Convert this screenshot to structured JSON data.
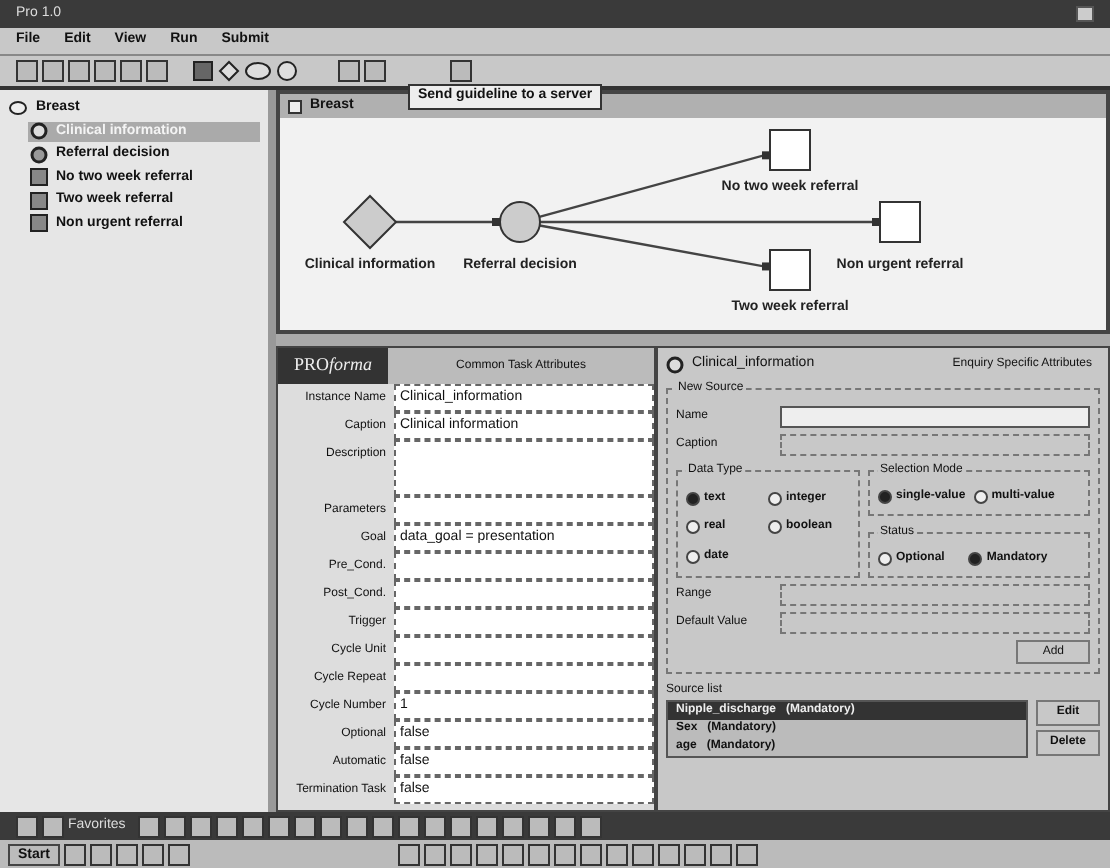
{
  "window": {
    "title": "Pro 1.0"
  },
  "menu": [
    "File",
    "Edit",
    "View",
    "Run",
    "Submit"
  ],
  "tooltip": "Send guideline to a server",
  "tree": {
    "root": "Breast",
    "children": [
      {
        "label": "Clinical information",
        "kind": "enquiry",
        "selected": true
      },
      {
        "label": "Referral decision",
        "kind": "decision",
        "selected": false
      },
      {
        "label": "No two week referral",
        "kind": "action",
        "selected": false
      },
      {
        "label": "Two week referral",
        "kind": "action",
        "selected": false
      },
      {
        "label": "Non urgent referral",
        "kind": "action",
        "selected": false
      }
    ]
  },
  "diagram": {
    "title": "Breast",
    "nodes": [
      {
        "label": "Clinical information",
        "kind": "enquiry"
      },
      {
        "label": "Referral decision",
        "kind": "decision"
      },
      {
        "label": "No two week referral",
        "kind": "action"
      },
      {
        "label": "Non urgent referral",
        "kind": "action"
      },
      {
        "label": "Two week referral",
        "kind": "action"
      }
    ]
  },
  "form": {
    "logo_main": "PRO",
    "logo_italic": "forma",
    "tab": "Common Task Attributes",
    "rows": [
      {
        "label": "Instance Name",
        "value": "Clinical_information",
        "tall": false
      },
      {
        "label": "Caption",
        "value": "Clinical information",
        "tall": false
      },
      {
        "label": "Description",
        "value": "",
        "tall": true
      },
      {
        "label": "Parameters",
        "value": "",
        "tall": false
      },
      {
        "label": "Goal",
        "value": "data_goal = presentation",
        "tall": false
      },
      {
        "label": "Pre_Cond.",
        "value": "",
        "tall": false
      },
      {
        "label": "Post_Cond.",
        "value": "",
        "tall": false
      },
      {
        "label": "Trigger",
        "value": "",
        "tall": false
      },
      {
        "label": "Cycle Unit",
        "value": "",
        "tall": false
      },
      {
        "label": "Cycle Repeat",
        "value": "",
        "tall": false
      },
      {
        "label": "Cycle Number",
        "value": "1",
        "tall": false
      },
      {
        "label": "Optional",
        "value": "false",
        "tall": false
      },
      {
        "label": "Automatic",
        "value": "false",
        "tall": false
      },
      {
        "label": "Termination Task",
        "value": "false",
        "tall": false
      }
    ]
  },
  "enquiry": {
    "name": "Clinical_information",
    "tab": "Enquiry Specific Attributes",
    "group": "New Source",
    "name_label": "Name",
    "caption_label": "Caption",
    "data_type": {
      "title": "Data Type",
      "options": [
        {
          "label": "text",
          "selected": true
        },
        {
          "label": "integer",
          "selected": false
        },
        {
          "label": "real",
          "selected": false
        },
        {
          "label": "boolean",
          "selected": false
        },
        {
          "label": "date",
          "selected": false
        }
      ]
    },
    "selection_mode": {
      "title": "Selection Mode",
      "options": [
        {
          "label": "single-value",
          "selected": true
        },
        {
          "label": "multi-value",
          "selected": false
        }
      ]
    },
    "status": {
      "title": "Status",
      "options": [
        {
          "label": "Optional",
          "selected": false
        },
        {
          "label": "Mandatory",
          "selected": true
        }
      ]
    },
    "range_label": "Range",
    "default_label": "Default Value",
    "add": "Add",
    "source_list_label": "Source list",
    "sources": [
      {
        "label": "Nipple_discharge   (Mandatory)",
        "selected": true
      },
      {
        "label": "Sex   (Mandatory)",
        "selected": false
      },
      {
        "label": "age   (Mandatory)",
        "selected": false
      }
    ],
    "buttons": [
      "Edit",
      "Delete"
    ]
  },
  "favorites": "Favorites",
  "start": "Start"
}
